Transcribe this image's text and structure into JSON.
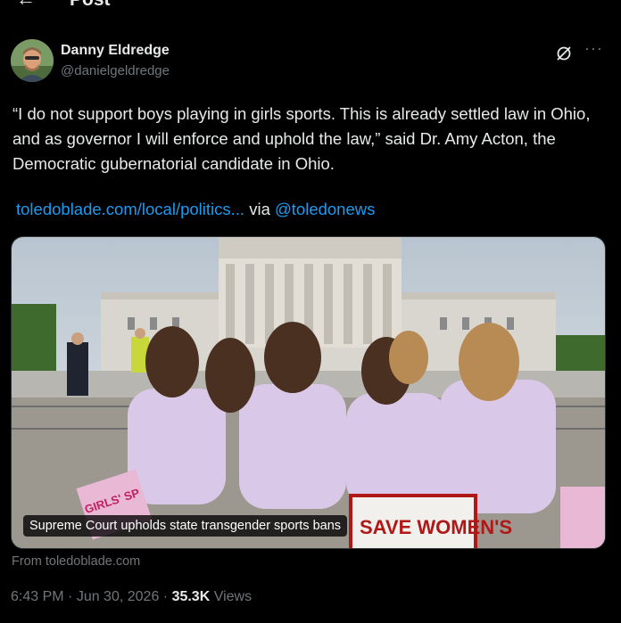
{
  "header": {
    "title": "Post",
    "back_icon": "back-arrow-icon"
  },
  "author": {
    "display_name": "Danny Eldredge",
    "handle": "@danielgeldredge"
  },
  "actions": {
    "grok_icon": "grok-icon",
    "more_icon": "more-icon"
  },
  "tweet": {
    "text": "“I do not support boys playing in girls sports. This is already settled law in Ohio, and as governor I will enforce and uphold the law,” said Dr. Amy Acton, the Democratic gubernatorial candidate in Ohio.",
    "link_text": "toledoblade.com/local/politics...",
    "via_text": " via ",
    "via_handle": "@toledonews"
  },
  "card": {
    "title": "Supreme Court upholds state transgender sports bans",
    "source": "From toledoblade.com",
    "sign_text_1": "SAVE WOMEN'S",
    "sign_text_2": "GIRLS' SP"
  },
  "meta": {
    "time": "6:43 PM",
    "sep1": " · ",
    "date": "Jun 30, 2026",
    "sep2": " · ",
    "views_count": "35.3K",
    "views_label": " Views"
  },
  "colors": {
    "link": "#1d9bf0",
    "muted": "#71767b",
    "background": "#000000",
    "text": "#e7e9ea"
  }
}
